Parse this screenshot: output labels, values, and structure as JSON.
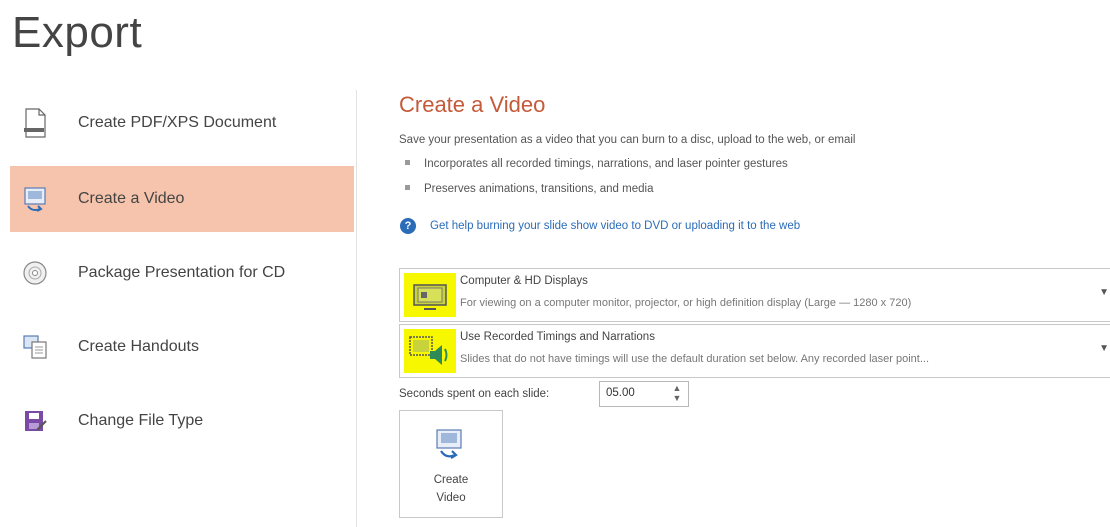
{
  "page": {
    "title": "Export"
  },
  "nav": {
    "items": [
      {
        "label": "Create PDF/XPS Document",
        "icon": "pdf-document-icon",
        "active": false
      },
      {
        "label": "Create a Video",
        "icon": "video-icon",
        "active": true
      },
      {
        "label": "Package Presentation for CD",
        "icon": "cd-icon",
        "active": false
      },
      {
        "label": "Create Handouts",
        "icon": "handouts-icon",
        "active": false
      },
      {
        "label": "Change File Type",
        "icon": "file-type-icon",
        "active": false
      }
    ],
    "active_color": "#f6c4ac"
  },
  "main": {
    "title": "Create a Video",
    "description": "Save your presentation as a video that you can burn to a disc, upload to the web, or email",
    "bullets": [
      "Incorporates all recorded timings, narrations, and laser pointer gestures",
      "Preserves animations, transitions, and media"
    ],
    "help_link": "Get help burning your slide show video to DVD or uploading it to the web",
    "quality_dropdown": {
      "title": "Computer & HD Displays",
      "subtitle": "For viewing on a computer monitor, projector, or high definition display  (Large — 1280 x 720)",
      "icon": "monitor-icon"
    },
    "timings_dropdown": {
      "title": "Use Recorded Timings and Narrations",
      "subtitle": "Slides that do not have timings will use the default duration set below. Any recorded laser point...",
      "icon": "narration-icon"
    },
    "seconds": {
      "label": "Seconds spent on each slide:",
      "value": "05.00"
    },
    "create_button": {
      "line1": "Create",
      "line2": "Video"
    },
    "highlight_color": "#f7f700",
    "title_color": "#c45a3a",
    "link_color": "#2b6cb8"
  }
}
